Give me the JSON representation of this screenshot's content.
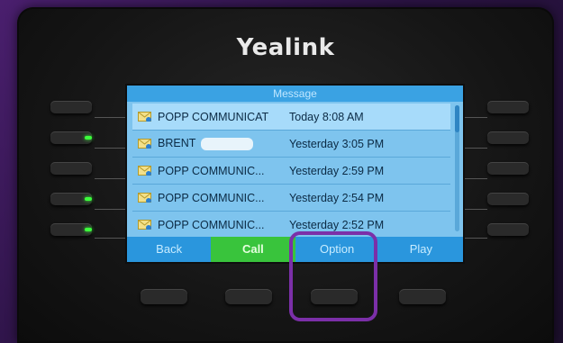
{
  "device": {
    "brand": "Yealink"
  },
  "screen": {
    "title": "Message",
    "messages": [
      {
        "sender": "POPP COMMUNICAT",
        "time": "Today 8:08 AM",
        "redacted": false
      },
      {
        "sender": "BRENT",
        "time": "Yesterday 3:05 PM",
        "redacted": true
      },
      {
        "sender": "POPP COMMUNIC...",
        "time": "Yesterday 2:59 PM",
        "redacted": false
      },
      {
        "sender": "POPP COMMUNIC...",
        "time": "Yesterday 2:54 PM",
        "redacted": false
      },
      {
        "sender": "POPP COMMUNIC...",
        "time": "Yesterday 2:52 PM",
        "redacted": false
      }
    ],
    "softkeys": [
      "Back",
      "Call",
      "Option",
      "Play"
    ]
  },
  "colors": {
    "screen_bg": "#7ec4ee",
    "softkey_bar": "#2a96dd",
    "call_key": "#39c43c",
    "led_green": "#3cff3c",
    "highlight_box": "#7b2fa8"
  },
  "icons": {
    "message": "envelope-icon"
  }
}
